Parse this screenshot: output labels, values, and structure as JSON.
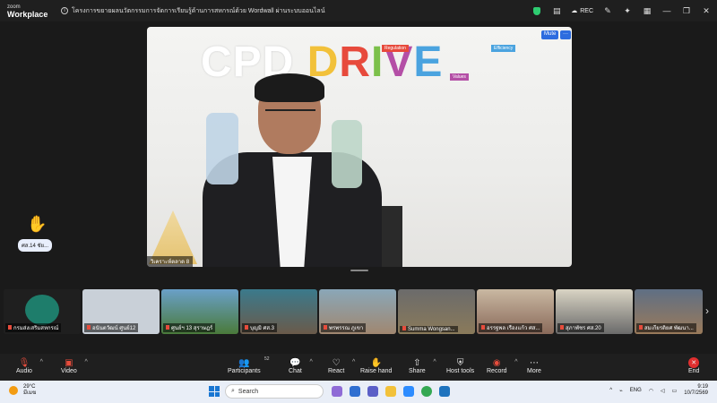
{
  "window": {
    "brand_top": "zoom",
    "brand_bottom": "Workplace",
    "meeting_title": "โครงการขยายผลนวัตกรรมการจัดการเรียนรู้ด้านการสหกรณ์ด้วย Wordwall ผ่านระบบออนไลน์",
    "rec_label": "REC"
  },
  "main_video": {
    "logo_cpd": "CPD",
    "logo_drive": [
      "D",
      "R",
      "I",
      "V",
      "E"
    ],
    "tags": {
      "regulation": "Regulation",
      "values": "Values",
      "efficiency": "Efficiency"
    },
    "mute_button": "Mute",
    "more_button": "···",
    "name_label": "วิเคราะห์ตลาด 8"
  },
  "side_participant": {
    "label": "ศส.14 ชัย..."
  },
  "gallery": [
    {
      "name": "กรมส่งเสริมสหกรณ์",
      "color": "#1e7d6b"
    },
    {
      "name": "อนันตวัฒน์ ศูนย์12",
      "color": "#c9d0d8"
    },
    {
      "name": "ศูนย์ฯ 13 สุราษฎร์",
      "color": "#6aa0c8"
    },
    {
      "name": "บุญมิ ศส.3",
      "color": "#3b7a8c"
    },
    {
      "name": "พรพรรณ ภูเขา",
      "color": "#8aa7b8"
    },
    {
      "name": "Summa Wongsan...",
      "color": "#6b6b6b"
    },
    {
      "name": "อรรฐพล เรืองแก้ว ศส...",
      "color": "#c9b8a2"
    },
    {
      "name": "สุภาพัชร ศส.20",
      "color": "#d9d4c4"
    },
    {
      "name": "สมเกียรติยศ พัฒนา...",
      "color": "#5f6f84"
    }
  ],
  "toolbar": {
    "audio": "Audio",
    "video": "Video",
    "participants": "Participants",
    "participants_count": "52",
    "chat": "Chat",
    "react": "React",
    "raise_hand": "Raise hand",
    "share": "Share",
    "host_tools": "Host tools",
    "record": "Record",
    "more": "More",
    "end": "End"
  },
  "taskbar": {
    "temp": "29°C",
    "weather_text": "มีเมฆ",
    "search_placeholder": "Search",
    "lang": "ENG",
    "time": "9:19",
    "date": "10/7/2569"
  },
  "colors": {
    "logo_d": "#f2c13a",
    "logo_r": "#e74a3c",
    "logo_i": "#7cc04a",
    "logo_v": "#b44fa6",
    "logo_e": "#4aa3df",
    "accent_blue": "#2d6cdf",
    "end_red": "#e02f2f"
  }
}
